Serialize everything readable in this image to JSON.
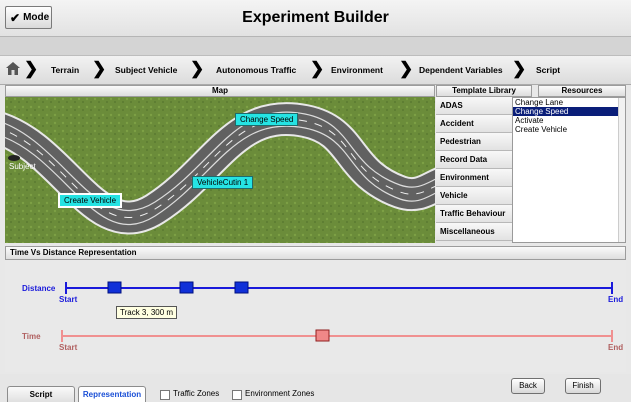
{
  "header": {
    "mode_label": "Mode",
    "title": "Experiment Builder"
  },
  "nav": {
    "items": [
      "Terrain",
      "Subject Vehicle",
      "Autonomous Traffic",
      "Environment",
      "Dependent Variables",
      "Script"
    ]
  },
  "panels": {
    "map_title": "Map",
    "template_title": "Template Library",
    "resources_title": "Resources"
  },
  "map": {
    "labels": {
      "change_speed": "Change Speed",
      "vehicle_cutin": "VehicleCutin 1",
      "create_vehicle": "Create Vehicle",
      "subject": "Subject"
    }
  },
  "template_library": {
    "items": [
      "ADAS",
      "Accident",
      "Pedestrian",
      "Record Data",
      "Environment",
      "Vehicle",
      "Traffic Behaviour",
      "Miscellaneous"
    ]
  },
  "resources": {
    "items": [
      "Change Lane",
      "Change Speed",
      "Activate",
      "Create Vehicle"
    ],
    "selected": "Change Speed"
  },
  "timeline": {
    "title": "Time Vs Distance Representation",
    "distance": {
      "label": "Distance",
      "start": "Start",
      "end": "End",
      "color": "#1a1adb"
    },
    "time": {
      "label": "Time",
      "start": "Start",
      "end": "End",
      "color": "#f09090"
    },
    "tooltip": "Track 3, 300 m"
  },
  "bottom": {
    "tabs": [
      "Script",
      "Representation"
    ],
    "active_tab": "Representation",
    "checkboxes": [
      "Traffic Zones",
      "Environment Zones"
    ],
    "back_label": "Back",
    "finish_label": "Finish"
  }
}
